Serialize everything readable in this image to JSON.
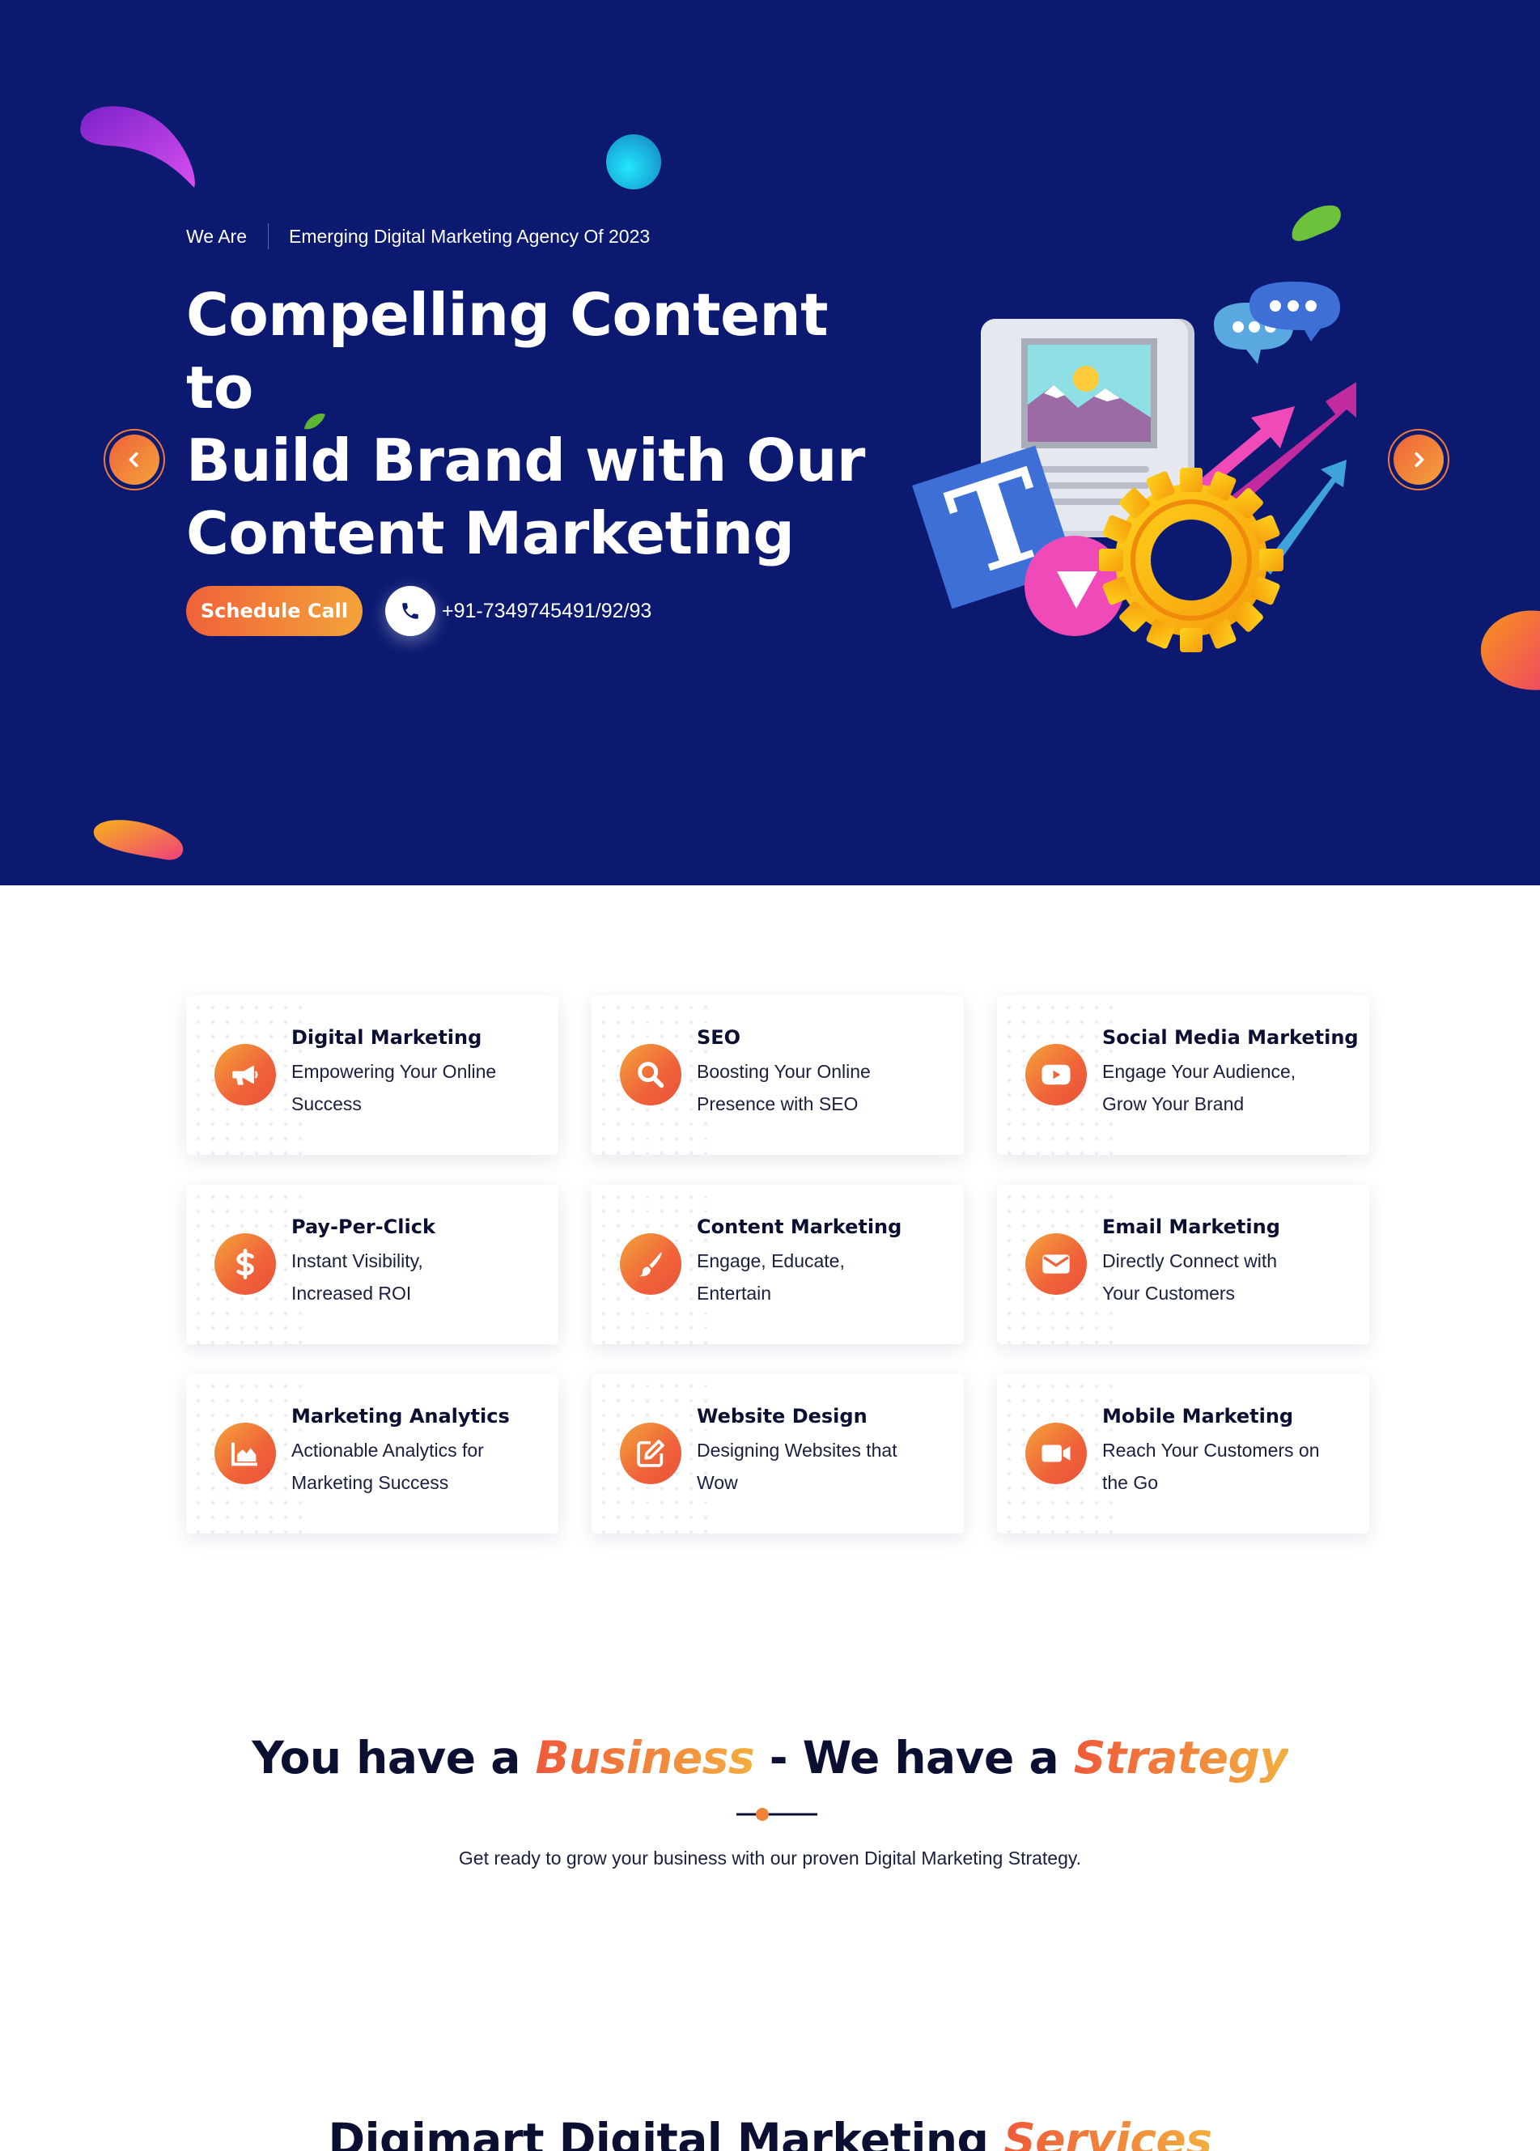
{
  "hero": {
    "eyebrow_lead": "We Are",
    "eyebrow_text": "Emerging Digital Marketing Agency Of 2023",
    "headline_line1": "Compelling Content to",
    "headline_line2": "Build Brand with Our",
    "headline_line3": "Content Marketing",
    "cta_label": "Schedule Call",
    "phone": "+91-7349745491/92/93",
    "bg_color": "#0b1a70",
    "accent_color": "#f0623a"
  },
  "services": [
    {
      "title": "Digital Marketing",
      "desc_line1": "Empowering Your Online",
      "desc_line2": "Success",
      "icon": "megaphone-icon"
    },
    {
      "title": "SEO",
      "desc_line1": "Boosting Your Online",
      "desc_line2": "Presence with SEO",
      "icon": "search-icon"
    },
    {
      "title": "Social Media Marketing",
      "desc_line1": "Engage Your Audience,",
      "desc_line2": "Grow Your Brand",
      "icon": "youtube-icon"
    },
    {
      "title": "Pay-Per-Click",
      "desc_line1": "Instant Visibility,",
      "desc_line2": "Increased ROI",
      "icon": "dollar-icon"
    },
    {
      "title": "Content Marketing",
      "desc_line1": "Engage, Educate,",
      "desc_line2": "Entertain",
      "icon": "paintbrush-icon"
    },
    {
      "title": "Email Marketing",
      "desc_line1": "Directly Connect with",
      "desc_line2": "Your Customers",
      "icon": "envelope-icon"
    },
    {
      "title": "Marketing Analytics",
      "desc_line1": "Actionable Analytics for",
      "desc_line2": "Marketing Success",
      "icon": "area-chart-icon"
    },
    {
      "title": "Website Design",
      "desc_line1": "Designing Websites that",
      "desc_line2": "Wow",
      "icon": "edit-icon"
    },
    {
      "title": "Mobile Marketing",
      "desc_line1": "Reach Your Customers on",
      "desc_line2": "the Go",
      "icon": "video-camera-icon"
    }
  ],
  "strategy": {
    "part1": "You have a ",
    "accent1": "Business",
    "part2": " - We have a ",
    "accent2": "Strategy",
    "subtitle": "Get ready to grow your business with our proven Digital Marketing Strategy."
  },
  "services_section": {
    "title_lead": "Digimart Digital Marketing ",
    "title_accent": "Services"
  }
}
